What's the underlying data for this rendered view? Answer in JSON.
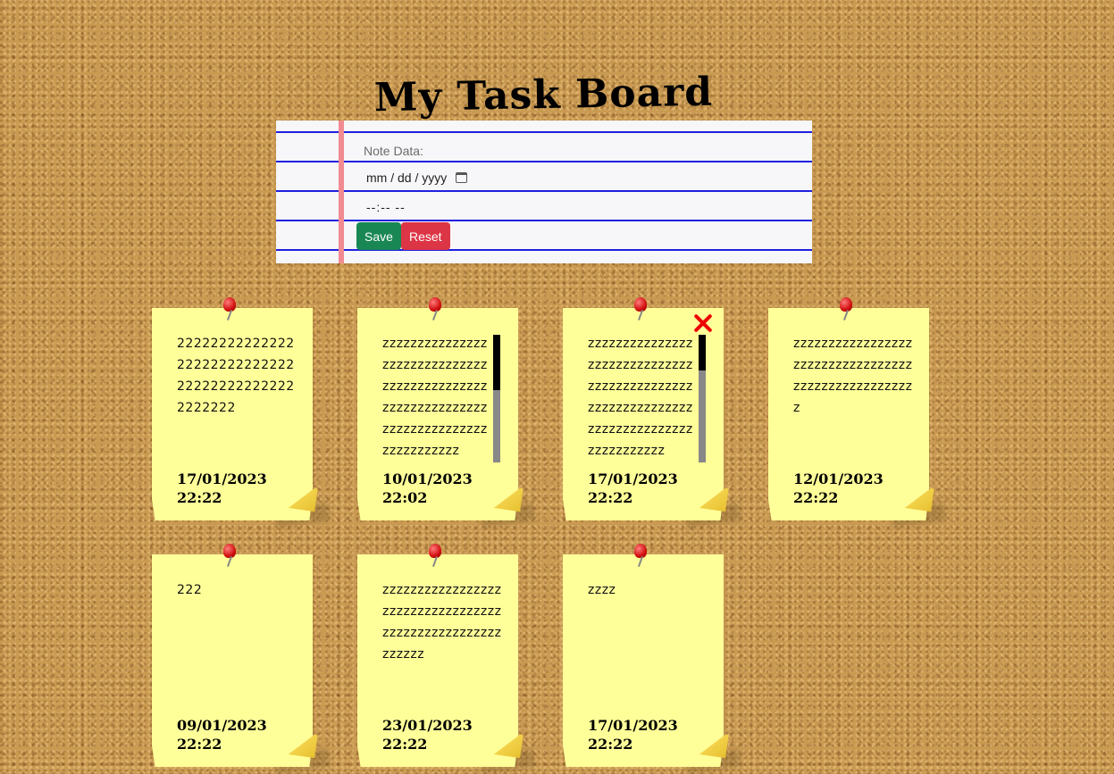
{
  "page": {
    "title": "My Task Board"
  },
  "form": {
    "note_placeholder": "Note Data:",
    "date_placeholder": "mm / dd / yyyy",
    "time_placeholder": "--:--  --",
    "save_label": "Save",
    "reset_label": "Reset"
  },
  "notes": [
    {
      "text": "2222222222222222222222222222222222222222222222222",
      "date": "17/01/2023",
      "time": "22:22"
    },
    {
      "text": "zzzzzzzzzzzzzzzzzzzzzzzzzzzzzzzzzzzzzzzzzzzzzzzzzzzzzzzzzzzzzzzzzzzzzzzzzzzzzzzzzzzzzz",
      "date": "10/01/2023",
      "time": "22:02"
    },
    {
      "text": "zzzzzzzzzzzzzzzzzzzzzzzzzzzzzzzzzzzzzzzzzzzzzzzzzzzzzzzzzzzzzzzzzzzzzzzzzzzzzzzzzzzzzz",
      "date": "17/01/2023",
      "time": "22:22"
    },
    {
      "text": "zzzzzzzzzzzzzzzzzzzzzzzzzzzzzzzzzzzzzzzzzzzzzzzzzzzz",
      "date": "12/01/2023",
      "time": "22:22"
    },
    {
      "text": "222",
      "date": "09/01/2023",
      "time": "22:22"
    },
    {
      "text": "zzzzzzzzzzzzzzzzzzzzzzzzzzzzzzzzzzzzzzzzzzzzzzzzzzzzzzzzz",
      "date": "23/01/2023",
      "time": "22:22"
    },
    {
      "text": "zzzz",
      "date": "17/01/2023",
      "time": "22:22"
    }
  ],
  "icons": {
    "pin": "pushpin-icon",
    "close": "close-icon",
    "calendar": "calendar-icon"
  },
  "colors": {
    "note": "#ffff99",
    "save": "#198754",
    "reset": "#dc3545",
    "close": "#e00000",
    "margin_line": "#f28a92",
    "rule_line": "#1f1fe0"
  }
}
